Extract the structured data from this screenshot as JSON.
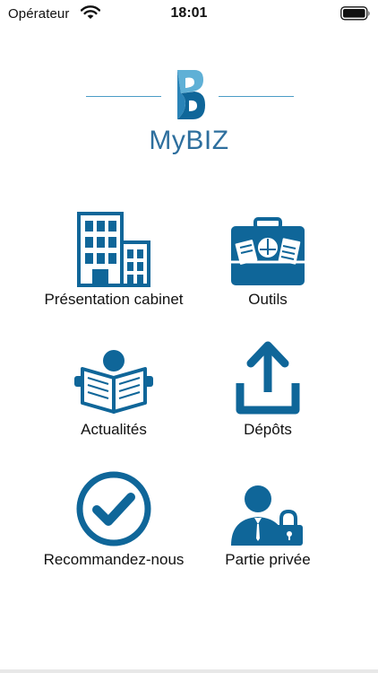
{
  "status_bar": {
    "carrier": "Opérateur",
    "time": "18:01"
  },
  "logo": {
    "text_my": "My",
    "text_biz": "BIZ"
  },
  "menu": {
    "items": [
      {
        "label": "Présentation cabinet",
        "icon": "building-icon"
      },
      {
        "label": "Outils",
        "icon": "toolbox-icon"
      },
      {
        "label": "Actualités",
        "icon": "newspaper-reader-icon"
      },
      {
        "label": "Dépôts",
        "icon": "upload-icon"
      },
      {
        "label": "Recommandez-nous",
        "icon": "check-circle-icon"
      },
      {
        "label": "Partie privée",
        "icon": "user-lock-icon"
      }
    ]
  },
  "colors": {
    "brand_blue": "#0f6699",
    "logo_light_blue": "#5fb0d6"
  }
}
